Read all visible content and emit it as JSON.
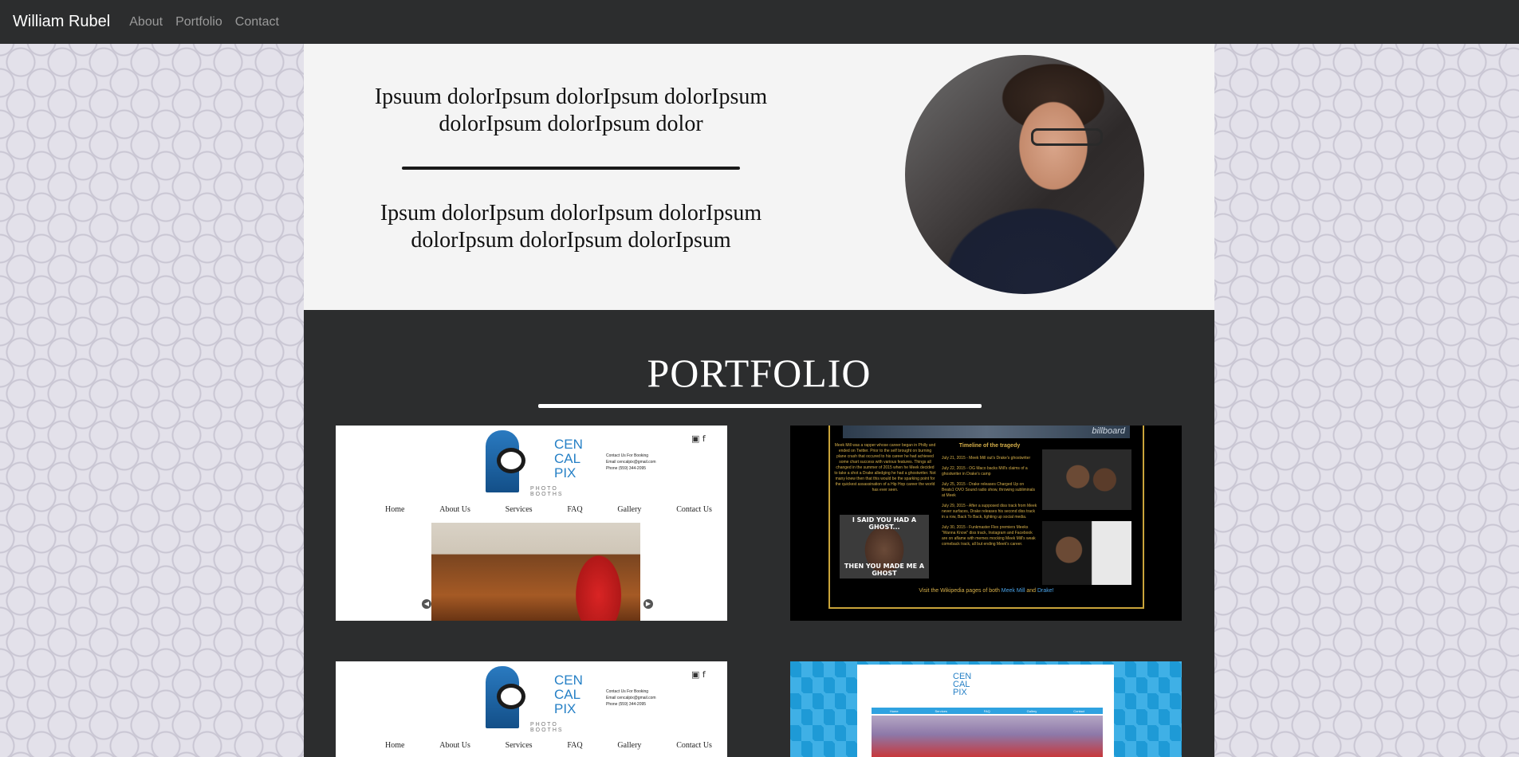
{
  "nav": {
    "brand": "William Rubel",
    "links": [
      "About",
      "Portfolio",
      "Contact"
    ]
  },
  "hero": {
    "paragraph1": "Ipsuum dolorIpsum dolorIpsum dolorIpsum dolorIpsum dolorIpsum dolor",
    "paragraph2": "Ipsum dolorIpsum dolorIpsum dolorIpsum dolorIpsum dolorIpsum dolorIpsum"
  },
  "portfolio": {
    "title": "PORTFOLIO",
    "cards": [
      {
        "site": "Cen Cal Pix",
        "logo_words": [
          "CEN",
          "CAL",
          "PIX"
        ],
        "tagline": "PHOTO BOOTHS",
        "contact_lines": [
          "Contact Us For Booking",
          "Email    cencalpix@gmail.com",
          "Phone    (559) 344-2095"
        ],
        "social": "▣ f",
        "nav": [
          "Home",
          "About Us",
          "Services",
          "FAQ",
          "Gallery",
          "Contact Us"
        ]
      },
      {
        "site": "Meek Mill Drake",
        "banner": "billboard",
        "timeline_title": "Timeline of the tragedy",
        "intro": "Meek Mill was a rapper whose career began in Philly and ended on Twitter. Prior to the self brought on burning plane crash that occured to his career he had achieved some chart success with various features. Things all changed in the summer of 2015 when he Meek decided to take a shot a Drake alledging he had a ghostwriter. Not many knew then that this would be the sparking point for the quickest assassination of a Hip Hop career the world has ever seen.",
        "timeline": [
          "July 21, 2015 - Meek Mill out's Drake's ghostwriter",
          "July 22, 2015 - OG Maco backs Mill's claims of a ghostwriter in Drake's camp",
          "July 25, 2015 - Drake releases Charged Up on Beats1 OVO Sound radio show, throwing subliminals at Meek",
          "July 29, 2015 - After a supposed diss track from Meek never surfaces, Drake releases his second diss track in a row, Back To Back, lighting up social media.",
          "July 30, 2015 - Funkmaster Flex premiers Meeks \"Wanna Know\" diss track, Instagram and Facebook are on aflame with memes mocking Meek Mill's weak comeback track, all but ending Meek's career."
        ],
        "meme_top": "I SAID YOU HAD A GHOST...",
        "meme_bottom": "THEN YOU MADE ME A GHOST",
        "footer_prefix": "Visit the Wikipedia pages of both",
        "footer_link1": "Meek Mill",
        "footer_and": "and",
        "footer_link2": "Drake!"
      },
      {
        "site": "Cen Cal Pix",
        "logo_words": [
          "CEN",
          "CAL",
          "PIX"
        ],
        "tagline": "PHOTO BOOTHS",
        "contact_lines": [
          "Contact Us For Booking",
          "Email    cencalpix@gmail.com",
          "Phone    (559) 344-2095"
        ],
        "social": "▣ f",
        "nav": [
          "Home",
          "About Us",
          "Services",
          "FAQ",
          "Gallery",
          "Contact Us"
        ]
      },
      {
        "site": "Cen Cal Pix alt",
        "logo_words": [
          "CEN",
          "CAL",
          "PIX"
        ],
        "nav": [
          "Home",
          "Services",
          "FAQ",
          "Gallery",
          "Contact"
        ]
      }
    ]
  },
  "colors": {
    "navbar": "#2c2d2e",
    "hero_bg": "#f4f4f4",
    "portfolio_bg": "#2c2d2e",
    "accent_blue": "#2680c6"
  }
}
